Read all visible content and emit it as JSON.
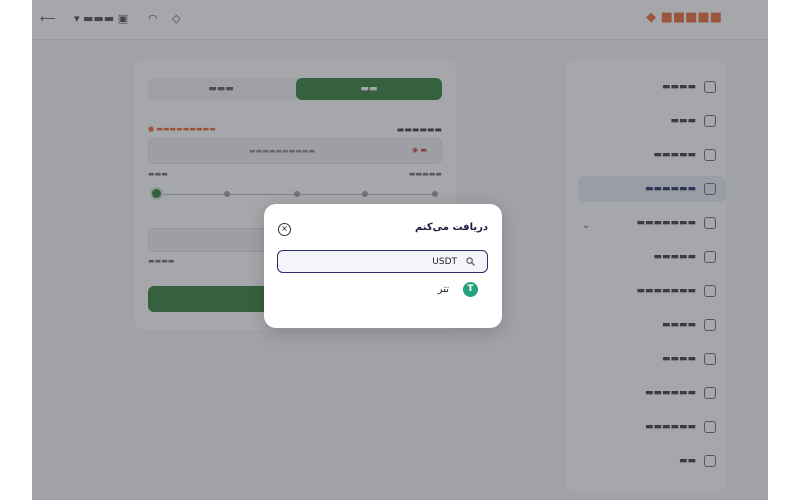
{
  "modal": {
    "title": "دریافت می‌کنم",
    "close_label": "×",
    "search": {
      "value": "USDT",
      "placeholder": ""
    },
    "results": [
      {
        "name": "تتر",
        "icon_glyph": "T",
        "icon_color": "#26a17b"
      }
    ]
  },
  "colors": {
    "accent": "#2b2f6b",
    "buy_green": "#2a7a2e",
    "brand": "#e8622c",
    "tether": "#26a17b"
  }
}
